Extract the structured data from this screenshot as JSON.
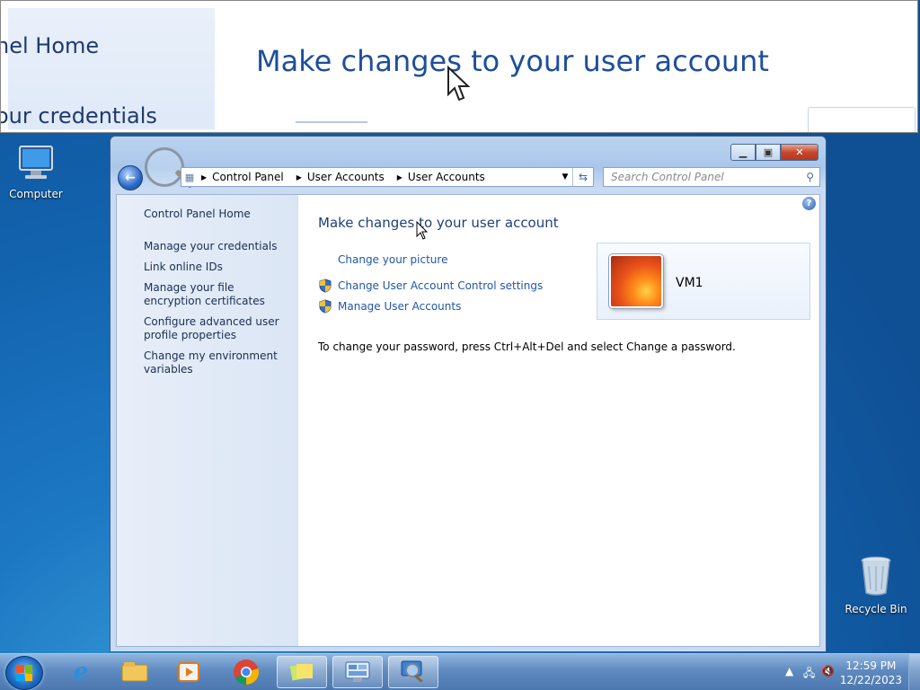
{
  "magnifier": {
    "left_line1": "nel Home",
    "left_line2": "our credentials",
    "title": "Make changes to your user account"
  },
  "desktop": {
    "computer_label": "Computer",
    "recycle_label": "Recycle Bin"
  },
  "window": {
    "breadcrumbs": [
      "Control Panel",
      "User Accounts",
      "User Accounts"
    ],
    "search_placeholder": "Search Control Panel",
    "left_pane": {
      "home": "Control Panel Home",
      "tasks": [
        "Manage your credentials",
        "Link online IDs",
        "Manage your file encryption certificates",
        "Configure advanced user profile properties",
        "Change my environment variables"
      ]
    },
    "main": {
      "title": "Make changes to your user account",
      "links": {
        "change_picture": "Change your picture",
        "uac": "Change User Account Control settings",
        "manage_accounts": "Manage User Accounts"
      },
      "user_name": "VM1",
      "password_note": "To change your password, press Ctrl+Alt+Del and select Change a password."
    }
  },
  "taskbar": {
    "time": "12:59 PM",
    "date": "12/22/2023"
  },
  "colors": {
    "link": "#1f57a7",
    "title": "#1e3f7a",
    "desktop": "#1262ad"
  }
}
